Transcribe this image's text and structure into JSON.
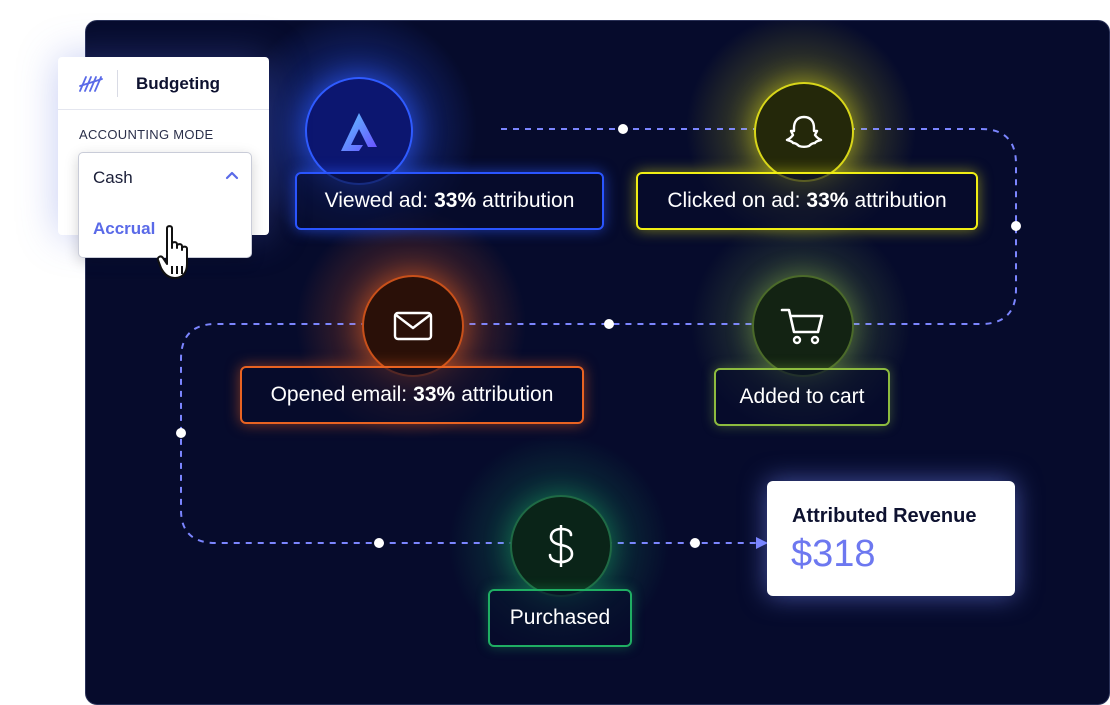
{
  "budget_panel": {
    "title": "Budgeting",
    "section_label": "ACCOUNTING MODE",
    "selected_option": "Cash",
    "options": [
      "Cash",
      "Accrual"
    ]
  },
  "journey_steps": [
    {
      "icon": "arcade-logo-icon",
      "accent": "#2f5bff",
      "label_prefix": "Viewed ad:",
      "label_bold": "33%",
      "label_suffix": "attribution"
    },
    {
      "icon": "snapchat-ghost-icon",
      "accent": "#f0ee14",
      "label_prefix": "Clicked on ad:",
      "label_bold": "33%",
      "label_suffix": "attribution"
    },
    {
      "icon": "envelope-icon",
      "accent": "#ff6a1f",
      "label_prefix": "Opened email:",
      "label_bold": "33%",
      "label_suffix": "attribution"
    },
    {
      "icon": "shopping-cart-icon",
      "accent": "#9ed14a",
      "label": "Added to cart"
    },
    {
      "icon": "dollar-sign-icon",
      "accent": "#1fc46b",
      "label": "Purchased"
    }
  ],
  "revenue": {
    "title": "Attributed Revenue",
    "value": "$318"
  },
  "colors": {
    "background": "#060b2c",
    "flow_line": "#7b85ff",
    "accent_text": "#6d78f0"
  }
}
